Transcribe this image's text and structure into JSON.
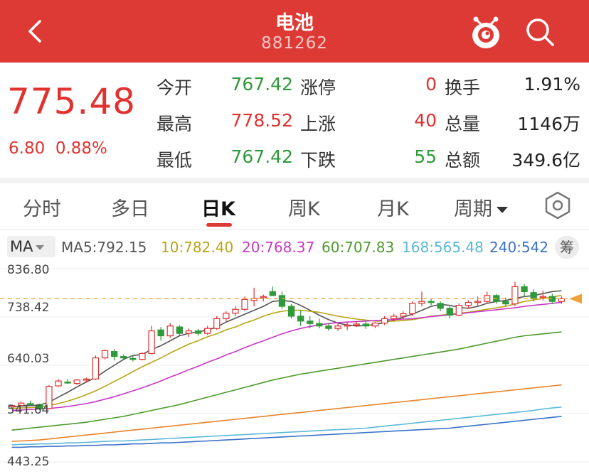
{
  "header": {
    "title": "电池",
    "code": "881262",
    "back_icon": "chevron-left-icon",
    "mascot_icon": "mascot-icon",
    "search_icon": "search-icon",
    "bg_color": "#de3a35"
  },
  "quote": {
    "price": "775.48",
    "change": "6.80",
    "change_pct": "0.88%",
    "rows": [
      {
        "l1": "今开",
        "v1": "767.42",
        "l2": "涨停",
        "v2": "0",
        "l3": "换手",
        "v3": "1.91%"
      },
      {
        "l1": "最高",
        "v1": "778.52",
        "l2": "上涨",
        "v2": "40",
        "l3": "总量",
        "v3": "1146万"
      },
      {
        "l1": "最低",
        "v1": "767.42",
        "l2": "下跌",
        "v2": "55",
        "l3": "总额",
        "v3": "349.6亿"
      }
    ],
    "colors": {
      "up": "#e0322f",
      "down": "#2e9a3a"
    }
  },
  "tabs": {
    "items": [
      "分时",
      "多日",
      "日K",
      "周K",
      "月K",
      "周期"
    ],
    "active": "日K",
    "settings_icon": "hexagon-settings-icon"
  },
  "ma": {
    "button": "MA",
    "items": [
      {
        "label": "MA5:",
        "value": "792.15",
        "color": "#555555"
      },
      {
        "label": "10:",
        "value": "782.40",
        "color": "#b8a418"
      },
      {
        "label": "20:",
        "value": "768.37",
        "color": "#c837c8"
      },
      {
        "label": "60:",
        "value": "707.83",
        "color": "#4e9a2e"
      },
      {
        "label": "168:",
        "value": "565.48",
        "color": "#5ab8d8"
      },
      {
        "label": "240:",
        "value": "542",
        "color": "#3a72c8"
      }
    ],
    "chou": "筹"
  },
  "chart_data": {
    "type": "candlestick",
    "y_ticks": [
      "836.80",
      "738.42",
      "640.03",
      "541.64",
      "443.25"
    ],
    "ylim": [
      443.25,
      836.8
    ],
    "last_price": 775.48,
    "candles": [
      [
        556,
        560,
        552,
        558
      ],
      [
        558,
        566,
        556,
        563
      ],
      [
        562,
        568,
        558,
        561
      ],
      [
        560,
        562,
        548,
        551
      ],
      [
        552,
        600,
        550,
        597
      ],
      [
        598,
        612,
        596,
        608
      ],
      [
        606,
        612,
        602,
        605
      ],
      [
        603,
        612,
        600,
        610
      ],
      [
        610,
        615,
        605,
        612
      ],
      [
        612,
        660,
        610,
        655
      ],
      [
        655,
        672,
        652,
        670
      ],
      [
        668,
        673,
        650,
        658
      ],
      [
        658,
        662,
        650,
        655
      ],
      [
        654,
        660,
        648,
        652
      ],
      [
        652,
        666,
        650,
        664
      ],
      [
        664,
        720,
        662,
        710
      ],
      [
        712,
        718,
        690,
        700
      ],
      [
        700,
        726,
        696,
        720
      ],
      [
        718,
        722,
        700,
        705
      ],
      [
        705,
        715,
        698,
        710
      ],
      [
        710,
        714,
        700,
        705
      ],
      [
        705,
        720,
        702,
        715
      ],
      [
        715,
        740,
        712,
        735
      ],
      [
        735,
        750,
        730,
        746
      ],
      [
        746,
        760,
        740,
        754
      ],
      [
        754,
        780,
        750,
        774
      ],
      [
        772,
        798,
        760,
        776
      ],
      [
        778,
        784,
        770,
        780
      ],
      [
        790,
        800,
        785,
        782
      ],
      [
        782,
        790,
        755,
        760
      ],
      [
        760,
        765,
        735,
        740
      ],
      [
        740,
        752,
        720,
        730
      ],
      [
        730,
        740,
        715,
        725
      ],
      [
        725,
        735,
        715,
        720
      ],
      [
        720,
        725,
        710,
        715
      ],
      [
        715,
        725,
        710,
        720
      ],
      [
        720,
        728,
        712,
        722
      ],
      [
        722,
        730,
        718,
        724
      ],
      [
        724,
        730,
        714,
        720
      ],
      [
        720,
        728,
        716,
        726
      ],
      [
        726,
        740,
        722,
        735
      ],
      [
        735,
        745,
        730,
        740
      ],
      [
        740,
        750,
        734,
        745
      ],
      [
        745,
        770,
        740,
        766
      ],
      [
        766,
        790,
        760,
        770
      ],
      [
        770,
        775,
        762,
        768
      ],
      [
        766,
        770,
        750,
        756
      ],
      [
        756,
        760,
        735,
        742
      ],
      [
        742,
        766,
        740,
        762
      ],
      [
        762,
        772,
        755,
        768
      ],
      [
        768,
        780,
        760,
        770
      ],
      [
        770,
        790,
        765,
        782
      ],
      [
        782,
        785,
        765,
        770
      ],
      [
        770,
        778,
        760,
        765
      ],
      [
        765,
        810,
        760,
        800
      ],
      [
        800,
        805,
        780,
        790
      ],
      [
        788,
        795,
        770,
        776
      ],
      [
        778,
        792,
        772,
        780
      ],
      [
        780,
        786,
        765,
        770
      ],
      [
        770,
        780,
        765,
        775.48
      ]
    ],
    "ma_series": {
      "MA5": [
        555,
        557,
        558,
        559,
        565,
        575,
        585,
        596,
        606,
        615,
        628,
        640,
        652,
        660,
        662,
        672,
        680,
        690,
        700,
        705,
        708,
        712,
        718,
        728,
        736,
        744,
        752,
        760,
        770,
        772,
        770,
        762,
        752,
        742,
        733,
        726,
        722,
        720,
        721,
        723,
        727,
        732,
        738,
        744,
        752,
        760,
        764,
        762,
        758,
        756,
        760,
        766,
        770,
        772,
        776,
        780,
        782,
        786,
        790,
        792
      ],
      "MA10": [
        552,
        553,
        554,
        555,
        558,
        562,
        567,
        573,
        580,
        588,
        597,
        607,
        617,
        627,
        637,
        646,
        655,
        665,
        674,
        683,
        690,
        698,
        704,
        712,
        718,
        726,
        732,
        740,
        746,
        750,
        752,
        752,
        750,
        748,
        744,
        740,
        737,
        734,
        732,
        730,
        730,
        730,
        731,
        733,
        736,
        740,
        742,
        744,
        746,
        748,
        751,
        754,
        757,
        760,
        765,
        770,
        773,
        776,
        779,
        782.4
      ],
      "MA20": [
        548,
        549,
        550,
        551,
        552,
        554,
        556,
        559,
        562,
        566,
        571,
        576,
        582,
        588,
        594,
        601,
        608,
        616,
        623,
        631,
        638,
        646,
        653,
        661,
        668,
        676,
        683,
        690,
        697,
        704,
        710,
        715,
        719,
        722,
        725,
        727,
        728,
        729,
        730,
        731,
        732,
        733,
        734,
        735,
        737,
        739,
        741,
        743,
        745,
        747,
        749,
        751,
        753,
        755,
        757,
        760,
        762,
        764,
        766,
        768.37
      ],
      "MA60": [
        508,
        510,
        512,
        514,
        516,
        518,
        520,
        522,
        524,
        527,
        530,
        533,
        536,
        540,
        544,
        548,
        552,
        556,
        560,
        565,
        570,
        575,
        580,
        585,
        590,
        595,
        600,
        605,
        610,
        614,
        618,
        622,
        625,
        628,
        631,
        634,
        637,
        640,
        643,
        646,
        649,
        652,
        655,
        658,
        661,
        664,
        667,
        670,
        673,
        677,
        681,
        685,
        689,
        693,
        697,
        700,
        702,
        704,
        706,
        707.83
      ],
      "MA120": [
        485,
        486,
        487,
        488,
        490,
        492,
        494,
        496,
        498,
        500,
        502,
        504,
        506,
        508,
        510,
        512,
        514,
        516,
        518,
        520,
        522,
        524,
        526,
        528,
        530,
        532,
        534,
        536,
        538,
        540,
        542,
        544,
        546,
        548,
        550,
        552,
        554,
        556,
        558,
        560,
        562,
        564,
        566,
        568,
        570,
        572,
        574,
        576,
        578,
        580,
        582,
        584,
        586,
        588,
        590,
        592,
        594,
        596,
        598,
        600
      ],
      "MA168": [
        478,
        479,
        479,
        480,
        480,
        481,
        482,
        482,
        483,
        484,
        485,
        486,
        486,
        487,
        488,
        489,
        490,
        491,
        492,
        493,
        494,
        495,
        496,
        497,
        498,
        499,
        500,
        501,
        502,
        503,
        504,
        505,
        506,
        507,
        508,
        509,
        510,
        511,
        512,
        514,
        516,
        518,
        520,
        522,
        524,
        526,
        528,
        530,
        532,
        534,
        536,
        538,
        540,
        542,
        544,
        546,
        548,
        551,
        553,
        555
      ],
      "MA240": [
        473,
        473,
        474,
        474,
        475,
        475,
        476,
        476,
        477,
        477,
        478,
        478,
        479,
        480,
        480,
        481,
        482,
        482,
        483,
        484,
        485,
        486,
        487,
        488,
        489,
        490,
        491,
        492,
        493,
        494,
        495,
        496,
        497,
        498,
        499,
        500,
        501,
        502,
        503,
        504,
        505,
        506,
        507,
        508,
        509,
        510,
        511,
        512,
        514,
        516,
        518,
        520,
        522,
        524,
        526,
        528,
        530,
        532,
        534,
        536
      ]
    },
    "ma_colors": {
      "MA5": "#555555",
      "MA10": "#b8a418",
      "MA20": "#c837c8",
      "MA60": "#4e9a2e",
      "MA120": "#e8842a",
      "MA168": "#5ab8d8",
      "MA240": "#3a72c8"
    },
    "colors": {
      "up": "#e0322f",
      "down": "#2e9a3a"
    },
    "grid": true
  }
}
